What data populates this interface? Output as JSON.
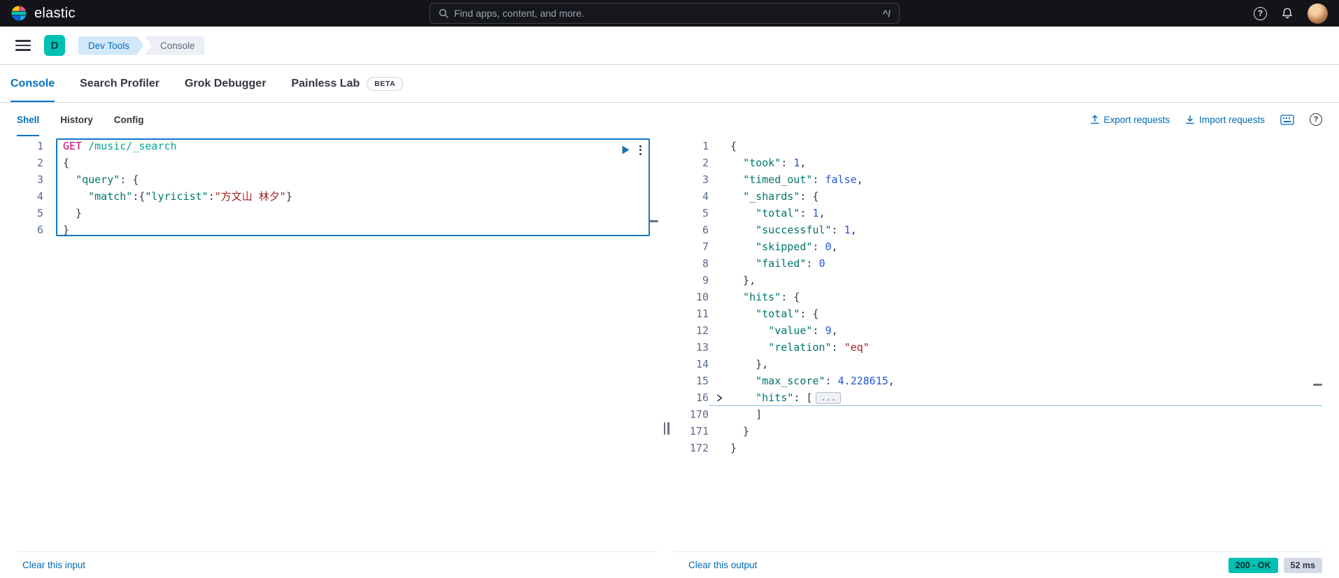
{
  "colors": {
    "topbar_bg": "#131419",
    "accent": "#0071c2",
    "link": "#006bb8",
    "success": "#00bfb3",
    "tok_method": "#c80a68",
    "tok_url": "#00a69b",
    "tok_key": "#00756c",
    "tok_string": "#a22222",
    "tok_number": "#2456d2",
    "gutter": "#5b6b8c"
  },
  "topbar": {
    "brand": "elastic",
    "search_placeholder": "Find apps, content, and more.",
    "search_shortcut": "^/"
  },
  "header": {
    "space_initial": "D",
    "breadcrumbs": [
      {
        "label": "Dev Tools"
      },
      {
        "label": "Console"
      }
    ]
  },
  "tabs": [
    {
      "label": "Console"
    },
    {
      "label": "Search Profiler"
    },
    {
      "label": "Grok Debugger"
    },
    {
      "label": "Painless Lab",
      "badge": "BETA"
    }
  ],
  "console": {
    "subtabs": [
      {
        "label": "Shell"
      },
      {
        "label": "History"
      },
      {
        "label": "Config"
      }
    ],
    "export_label": "Export requests",
    "import_label": "Import requests"
  },
  "editor": {
    "clear_label": "Clear this input",
    "lines": [
      {
        "n": "1",
        "tokens": [
          [
            "m",
            "GET"
          ],
          [
            "p",
            " "
          ],
          [
            "u",
            "/music/_search"
          ]
        ]
      },
      {
        "n": "2",
        "tokens": [
          [
            "p",
            "{"
          ]
        ]
      },
      {
        "n": "3",
        "tokens": [
          [
            "p",
            "  "
          ],
          [
            "k",
            "\"query\""
          ],
          [
            "p",
            ": {"
          ]
        ]
      },
      {
        "n": "4",
        "tokens": [
          [
            "p",
            "    "
          ],
          [
            "k",
            "\"match\""
          ],
          [
            "p",
            ":{"
          ],
          [
            "k",
            "\"lyricist\""
          ],
          [
            "p",
            ":"
          ],
          [
            "s",
            "\"方文山 林夕\""
          ],
          [
            "p",
            "}"
          ]
        ]
      },
      {
        "n": "5",
        "tokens": [
          [
            "p",
            "  }"
          ]
        ]
      },
      {
        "n": "6",
        "tokens": [
          [
            "p",
            "}"
          ]
        ]
      }
    ]
  },
  "output": {
    "clear_label": "Clear this output",
    "status_badge": "200 - OK",
    "time_badge": "52 ms",
    "lines": [
      {
        "n": "1",
        "tokens": [
          [
            "p",
            "{"
          ]
        ]
      },
      {
        "n": "2",
        "tokens": [
          [
            "p",
            "  "
          ],
          [
            "k",
            "\"took\""
          ],
          [
            "p",
            ": "
          ],
          [
            "n",
            "1"
          ],
          [
            "p",
            ","
          ]
        ]
      },
      {
        "n": "3",
        "tokens": [
          [
            "p",
            "  "
          ],
          [
            "k",
            "\"timed_out\""
          ],
          [
            "p",
            ": "
          ],
          [
            "b",
            "false"
          ],
          [
            "p",
            ","
          ]
        ]
      },
      {
        "n": "4",
        "tokens": [
          [
            "p",
            "  "
          ],
          [
            "k",
            "\"_shards\""
          ],
          [
            "p",
            ": {"
          ]
        ]
      },
      {
        "n": "5",
        "tokens": [
          [
            "p",
            "    "
          ],
          [
            "k",
            "\"total\""
          ],
          [
            "p",
            ": "
          ],
          [
            "n",
            "1"
          ],
          [
            "p",
            ","
          ]
        ]
      },
      {
        "n": "6",
        "tokens": [
          [
            "p",
            "    "
          ],
          [
            "k",
            "\"successful\""
          ],
          [
            "p",
            ": "
          ],
          [
            "n",
            "1"
          ],
          [
            "p",
            ","
          ]
        ]
      },
      {
        "n": "7",
        "tokens": [
          [
            "p",
            "    "
          ],
          [
            "k",
            "\"skipped\""
          ],
          [
            "p",
            ": "
          ],
          [
            "n",
            "0"
          ],
          [
            "p",
            ","
          ]
        ]
      },
      {
        "n": "8",
        "tokens": [
          [
            "p",
            "    "
          ],
          [
            "k",
            "\"failed\""
          ],
          [
            "p",
            ": "
          ],
          [
            "n",
            "0"
          ]
        ]
      },
      {
        "n": "9",
        "tokens": [
          [
            "p",
            "  },"
          ]
        ]
      },
      {
        "n": "10",
        "tokens": [
          [
            "p",
            "  "
          ],
          [
            "k",
            "\"hits\""
          ],
          [
            "p",
            ": {"
          ]
        ]
      },
      {
        "n": "11",
        "tokens": [
          [
            "p",
            "    "
          ],
          [
            "k",
            "\"total\""
          ],
          [
            "p",
            ": {"
          ]
        ]
      },
      {
        "n": "12",
        "tokens": [
          [
            "p",
            "      "
          ],
          [
            "k",
            "\"value\""
          ],
          [
            "p",
            ": "
          ],
          [
            "n",
            "9"
          ],
          [
            "p",
            ","
          ]
        ]
      },
      {
        "n": "13",
        "tokens": [
          [
            "p",
            "      "
          ],
          [
            "k",
            "\"relation\""
          ],
          [
            "p",
            ": "
          ],
          [
            "s",
            "\"eq\""
          ]
        ]
      },
      {
        "n": "14",
        "tokens": [
          [
            "p",
            "    },"
          ]
        ]
      },
      {
        "n": "15",
        "tokens": [
          [
            "p",
            "    "
          ],
          [
            "k",
            "\"max_score\""
          ],
          [
            "p",
            ": "
          ],
          [
            "n",
            "4.228615"
          ],
          [
            "p",
            ","
          ]
        ]
      },
      {
        "n": "16",
        "active": true,
        "fold": true,
        "tokens": [
          [
            "p",
            "    "
          ],
          [
            "k",
            "\"hits\""
          ],
          [
            "p",
            ": ["
          ],
          [
            "fold",
            "..."
          ]
        ]
      },
      {
        "n": "170",
        "tokens": [
          [
            "p",
            "    ]"
          ]
        ]
      },
      {
        "n": "171",
        "tokens": [
          [
            "p",
            "  }"
          ]
        ]
      },
      {
        "n": "172",
        "tokens": [
          [
            "p",
            "}"
          ]
        ]
      }
    ]
  }
}
